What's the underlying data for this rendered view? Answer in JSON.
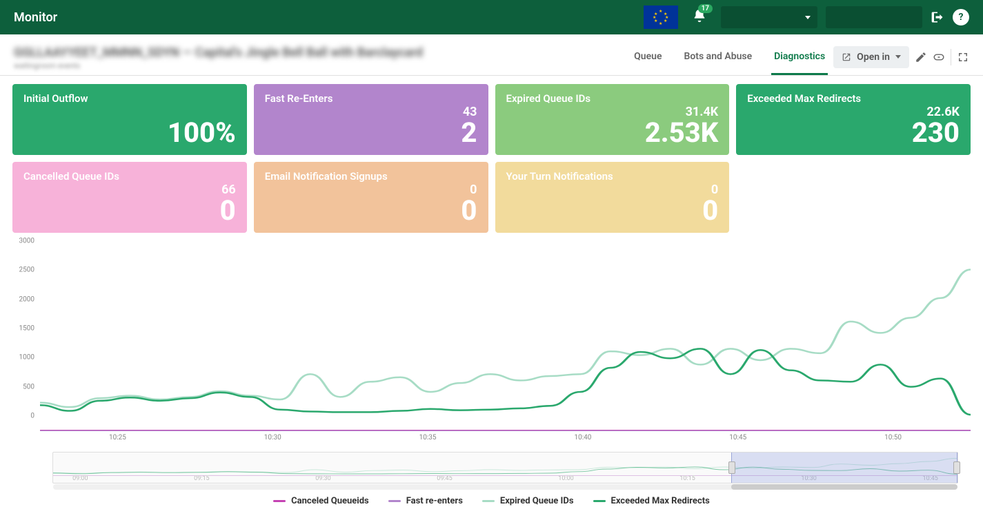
{
  "header": {
    "title": "Monitor",
    "notif_count": "17"
  },
  "subheader": {
    "blurred_title": "GGLLAAYYEET_MMNN_SDYN — Capital's Jingle Bell Ball with Barclaycard",
    "blurred_sub": "waitingroom events"
  },
  "tabs": {
    "queue": "Queue",
    "bots": "Bots and Abuse",
    "diagnostics": "Diagnostics",
    "open_in": "Open in"
  },
  "cards": [
    {
      "title": "Initial Outflow",
      "small": "",
      "big": "100%",
      "cls": "card-green1"
    },
    {
      "title": "Fast Re-Enters",
      "small": "43",
      "big": "2",
      "cls": "card-purple"
    },
    {
      "title": "Expired Queue IDs",
      "small": "31.4K",
      "big": "2.53K",
      "cls": "card-lightgreen"
    },
    {
      "title": "Exceeded Max Redirects",
      "small": "22.6K",
      "big": "230",
      "cls": "card-green2"
    },
    {
      "title": "Cancelled Queue IDs",
      "small": "66",
      "big": "0",
      "cls": "card-pink"
    },
    {
      "title": "Email Notification Signups",
      "small": "0",
      "big": "0",
      "cls": "card-orange"
    },
    {
      "title": "Your Turn Notifications",
      "small": "0",
      "big": "0",
      "cls": "card-yellow"
    }
  ],
  "chart_data": {
    "type": "line",
    "ylim": [
      0,
      3000
    ],
    "yticks": [
      0,
      500,
      1000,
      1500,
      2000,
      2500,
      3000
    ],
    "xticks": [
      "10:25",
      "10:30",
      "10:35",
      "10:40",
      "10:45",
      "10:50"
    ],
    "x": [
      0,
      1,
      2,
      3,
      4,
      5,
      6,
      7,
      8,
      9,
      10,
      11,
      12,
      13,
      14,
      15,
      16,
      17,
      18,
      19,
      20,
      21,
      22,
      23,
      24,
      25,
      26,
      27,
      28,
      29,
      30,
      31
    ],
    "series": [
      {
        "name": "Canceled Queueids",
        "color": "#c542b3",
        "values": [
          5,
          5,
          5,
          5,
          5,
          5,
          5,
          5,
          5,
          5,
          5,
          5,
          5,
          5,
          5,
          5,
          5,
          5,
          5,
          5,
          5,
          5,
          5,
          5,
          5,
          5,
          5,
          5,
          5,
          5,
          5,
          5
        ]
      },
      {
        "name": "Fast re-enters",
        "color": "#b285cc",
        "values": [
          0,
          0,
          0,
          0,
          0,
          0,
          0,
          0,
          0,
          0,
          0,
          0,
          0,
          0,
          0,
          0,
          0,
          0,
          0,
          0,
          0,
          0,
          0,
          0,
          0,
          0,
          0,
          0,
          0,
          0,
          0,
          0
        ]
      },
      {
        "name": "Expired Queue IDs",
        "color": "#a7dcc5",
        "values": [
          450,
          380,
          520,
          560,
          500,
          540,
          630,
          560,
          500,
          900,
          540,
          780,
          850,
          620,
          760,
          900,
          800,
          870,
          900,
          1260,
          1200,
          1300,
          1050,
          1300,
          1120,
          1300,
          1230,
          1730,
          1550,
          1790,
          2100,
          2550
        ]
      },
      {
        "name": "Exceeded Max Redirects",
        "color": "#2aa86d",
        "values": [
          410,
          320,
          480,
          530,
          480,
          520,
          610,
          540,
          340,
          310,
          300,
          300,
          320,
          350,
          330,
          340,
          360,
          400,
          620,
          1000,
          1250,
          1150,
          1300,
          900,
          1280,
          960,
          800,
          780,
          1050,
          700,
          830,
          260
        ]
      }
    ],
    "range_xticks": [
      "09:00",
      "09:15",
      "09:30",
      "09:45",
      "10:00",
      "10:15",
      "10:30",
      "10:45"
    ],
    "range_selection": {
      "start_pct": 75,
      "end_pct": 100
    }
  },
  "legend": [
    {
      "label": "Canceled Queueids",
      "color": "#c542b3"
    },
    {
      "label": "Fast re-enters",
      "color": "#b285cc"
    },
    {
      "label": "Expired Queue IDs",
      "color": "#a7dcc5"
    },
    {
      "label": "Exceeded Max Redirects",
      "color": "#2aa86d"
    }
  ]
}
